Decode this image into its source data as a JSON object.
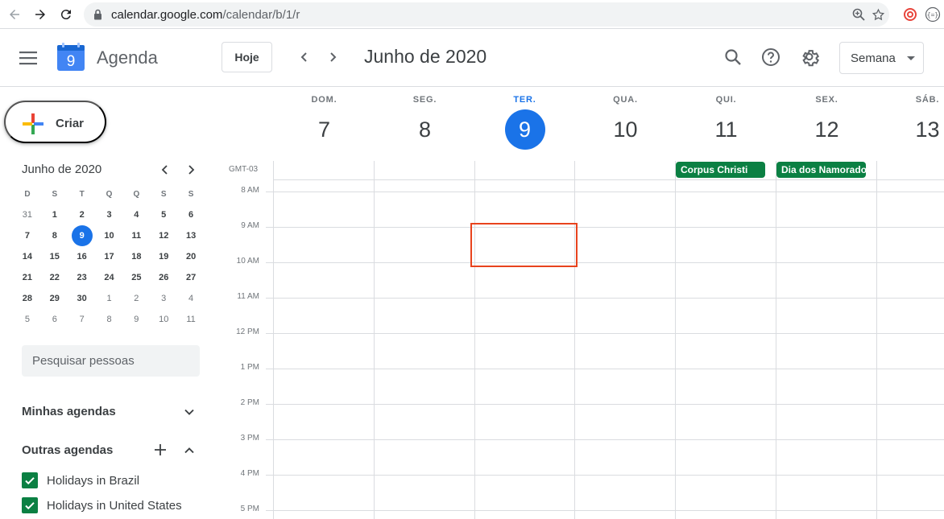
{
  "browser": {
    "url_host": "calendar.google.com",
    "url_path": "/calendar/b/1/r"
  },
  "header": {
    "logo_day": "9",
    "app_name": "Agenda",
    "today_label": "Hoje",
    "month_title": "Junho de 2020",
    "view_label": "Semana"
  },
  "sidebar": {
    "create_label": "Criar",
    "mini_title": "Junho de 2020",
    "weekday_initials": [
      "D",
      "S",
      "T",
      "Q",
      "Q",
      "S",
      "S"
    ],
    "weeks": [
      [
        "31",
        "1",
        "2",
        "3",
        "4",
        "5",
        "6"
      ],
      [
        "7",
        "8",
        "9",
        "10",
        "11",
        "12",
        "13"
      ],
      [
        "14",
        "15",
        "16",
        "17",
        "18",
        "19",
        "20"
      ],
      [
        "21",
        "22",
        "23",
        "24",
        "25",
        "26",
        "27"
      ],
      [
        "28",
        "29",
        "30",
        "1",
        "2",
        "3",
        "4"
      ],
      [
        "5",
        "6",
        "7",
        "8",
        "9",
        "10",
        "11"
      ]
    ],
    "people_placeholder": "Pesquisar pessoas",
    "my_calendars": "Minhas agendas",
    "other_calendars": "Outras agendas",
    "calendars": [
      {
        "name": "Holidays in Brazil"
      },
      {
        "name": "Holidays in United States"
      }
    ]
  },
  "week": {
    "timezone": "GMT-03",
    "days": [
      {
        "dow": "DOM.",
        "num": "7"
      },
      {
        "dow": "SEG.",
        "num": "8"
      },
      {
        "dow": "TER.",
        "num": "9"
      },
      {
        "dow": "QUA.",
        "num": "10"
      },
      {
        "dow": "QUI.",
        "num": "11"
      },
      {
        "dow": "SEX.",
        "num": "12"
      },
      {
        "dow": "SÁB.",
        "num": "13"
      }
    ],
    "hours": [
      "8 AM",
      "9 AM",
      "10 AM",
      "11 AM",
      "12 PM",
      "1 PM",
      "2 PM",
      "3 PM",
      "4 PM",
      "5 PM"
    ],
    "allday_events": [
      {
        "title": "Corpus Christi"
      },
      {
        "title": "Dia dos Namorados"
      }
    ]
  },
  "colors": {
    "accent": "#1a73e8",
    "event_green": "#0b8043",
    "selection": "#e8431d"
  }
}
